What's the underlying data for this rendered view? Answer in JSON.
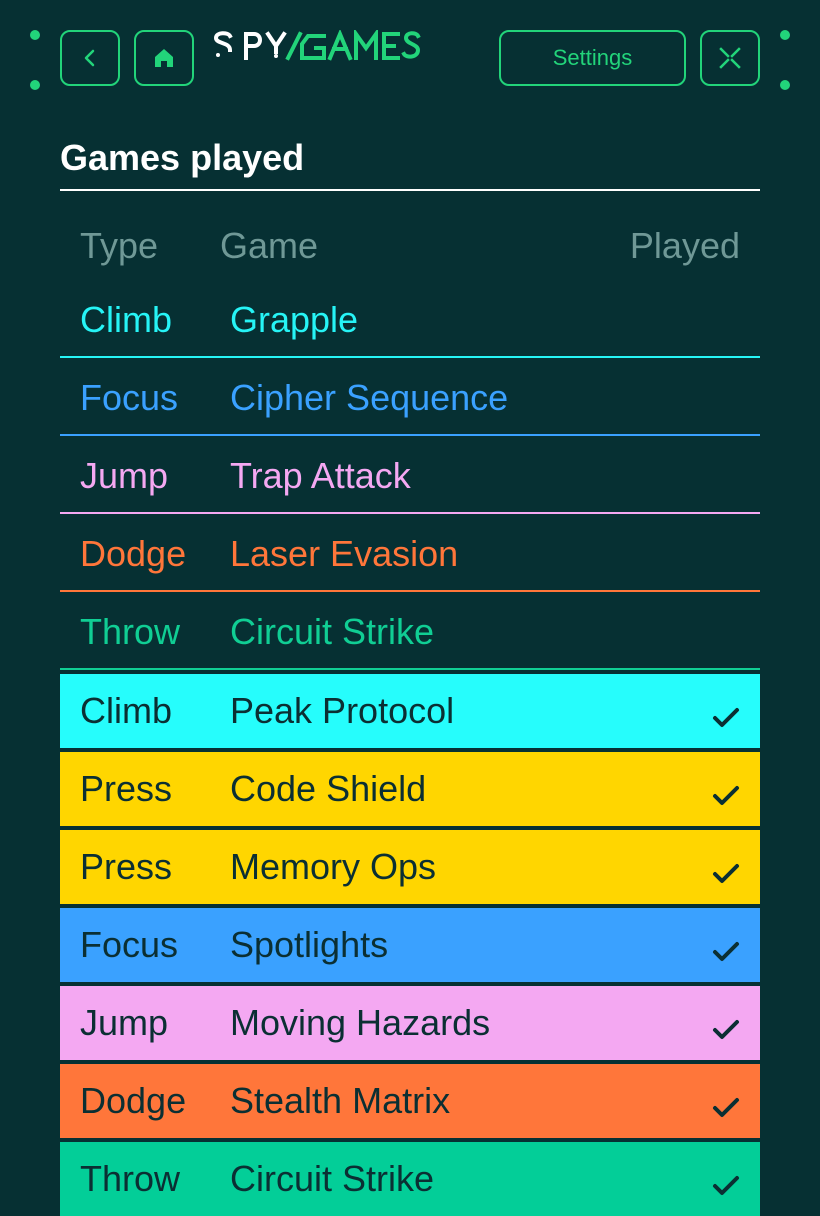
{
  "brand": {
    "name": "SPYGAMES",
    "color": "#22d47a"
  },
  "header": {
    "back_icon": "chevron-left-icon",
    "home_icon": "home-icon",
    "settings_label": "Settings",
    "close_icon": "close-icon"
  },
  "section": {
    "title": "Games played"
  },
  "table": {
    "columns": {
      "type": "Type",
      "game": "Game",
      "played": "Played"
    },
    "rows": [
      {
        "type": "Climb",
        "game": "Grapple",
        "played": false,
        "color": "#26f4f6"
      },
      {
        "type": "Focus",
        "game": "Cipher Sequence",
        "played": false,
        "color": "#3aa1ff"
      },
      {
        "type": "Jump",
        "game": "Trap Attack",
        "played": false,
        "color": "#f4a8f2"
      },
      {
        "type": "Dodge",
        "game": "Laser Evasion",
        "played": false,
        "color": "#ff763a"
      },
      {
        "type": "Throw",
        "game": "Circuit Strike",
        "played": false,
        "color": "#10ce94"
      },
      {
        "type": "Climb",
        "game": "Peak Protocol",
        "played": true,
        "color": "#26fdfc"
      },
      {
        "type": "Press",
        "game": "Code Shield",
        "played": true,
        "color": "#ffd600"
      },
      {
        "type": "Press",
        "game": "Memory Ops",
        "played": true,
        "color": "#ffd600"
      },
      {
        "type": "Focus",
        "game": "Spotlights",
        "played": true,
        "color": "#3aa1ff"
      },
      {
        "type": "Jump",
        "game": "Moving Hazards",
        "played": true,
        "color": "#f4a8f2"
      },
      {
        "type": "Dodge",
        "game": "Stealth Matrix",
        "played": true,
        "color": "#ff763a"
      },
      {
        "type": "Throw",
        "game": "Circuit Strike",
        "played": true,
        "color": "#03ce98"
      }
    ]
  }
}
